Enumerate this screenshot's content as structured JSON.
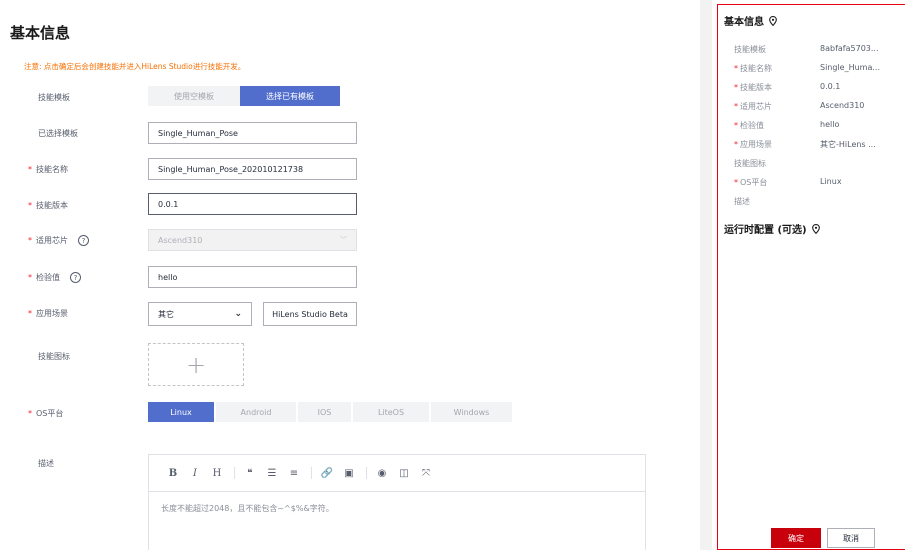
{
  "form": {
    "title": "基本信息",
    "notice": "注意: 点击确定后会创建技能并进入HiLens Studio进行技能开发。",
    "template": {
      "label": "技能模板",
      "blank_option": "使用空模板",
      "existing_option": "选择已有模板"
    },
    "selected_template": {
      "label": "已选择模板",
      "value": "Single_Human_Pose"
    },
    "skill_name": {
      "label": "技能名称",
      "value": "Single_Human_Pose_202010121738"
    },
    "skill_version": {
      "label": "技能版本",
      "value": "0.0.1"
    },
    "chip": {
      "label": "适用芯片",
      "value": "Ascend310",
      "help": "?"
    },
    "check_value": {
      "label": "检验值",
      "value": "hello",
      "help": "?"
    },
    "scenario": {
      "label": "应用场景",
      "value": "其它",
      "extra": "HiLens Studio Beta"
    },
    "skill_icon": {
      "label": "技能图标"
    },
    "os": {
      "label": "OS平台",
      "options": [
        "Linux",
        "Android",
        "IOS",
        "LiteOS",
        "Windows"
      ],
      "selected": "Linux"
    },
    "description": {
      "label": "描述",
      "placeholder": "长度不能超过2048，且不能包含~^$%&字符。"
    }
  },
  "editor_toolbar": [
    "B",
    "I",
    "H",
    "❝",
    "☰",
    "≡",
    "🔗",
    "▣",
    "◉",
    "◫",
    "⤧"
  ],
  "summary": {
    "basic_title": "基本信息",
    "items": [
      {
        "label": "技能模板",
        "value": "8abfafa5703...",
        "required": false
      },
      {
        "label": "技能名称",
        "value": "Single_Huma...",
        "required": true
      },
      {
        "label": "技能版本",
        "value": "0.0.1",
        "required": true
      },
      {
        "label": "适用芯片",
        "value": "Ascend310",
        "required": true
      },
      {
        "label": "检验值",
        "value": "hello",
        "required": true
      },
      {
        "label": "应用场景",
        "value": "其它-HiLens ...",
        "required": true
      },
      {
        "label": "技能图标",
        "value": "",
        "required": false
      },
      {
        "label": "OS平台",
        "value": "Linux",
        "required": true
      },
      {
        "label": "描述",
        "value": "",
        "required": false
      }
    ],
    "runtime_title": "运行时配置 (可选)",
    "confirm": "确定",
    "cancel": "取消"
  },
  "colors": {
    "primary": "#526ecc",
    "confirm": "#c7000b",
    "notice": "#f66f01",
    "required": "#f5222d",
    "panel_border": "#e60012"
  }
}
